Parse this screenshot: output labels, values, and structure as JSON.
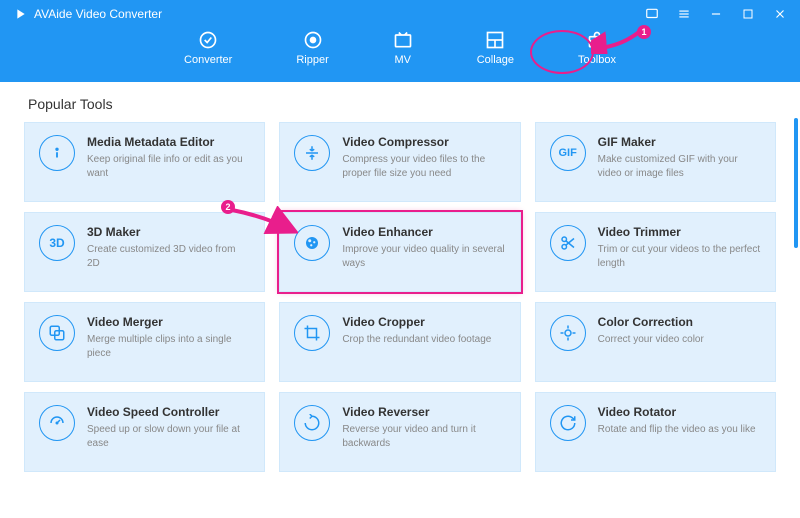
{
  "app": {
    "title": "AVAide Video Converter"
  },
  "tabs": [
    {
      "label": "Converter",
      "icon": "converter"
    },
    {
      "label": "Ripper",
      "icon": "ripper"
    },
    {
      "label": "MV",
      "icon": "mv"
    },
    {
      "label": "Collage",
      "icon": "collage"
    },
    {
      "label": "Toolbox",
      "icon": "toolbox"
    }
  ],
  "section": {
    "title": "Popular Tools"
  },
  "tools": [
    {
      "title": "Media Metadata Editor",
      "desc": "Keep original file info or edit as you want",
      "icon": "info"
    },
    {
      "title": "Video Compressor",
      "desc": "Compress your video files to the proper file size you need",
      "icon": "compress"
    },
    {
      "title": "GIF Maker",
      "desc": "Make customized GIF with your video or image files",
      "icon": "gif"
    },
    {
      "title": "3D Maker",
      "desc": "Create customized 3D video from 2D",
      "icon": "3d"
    },
    {
      "title": "Video Enhancer",
      "desc": "Improve your video quality in several ways",
      "icon": "enhance"
    },
    {
      "title": "Video Trimmer",
      "desc": "Trim or cut your videos to the perfect length",
      "icon": "trim"
    },
    {
      "title": "Video Merger",
      "desc": "Merge multiple clips into a single piece",
      "icon": "merge"
    },
    {
      "title": "Video Cropper",
      "desc": "Crop the redundant video footage",
      "icon": "crop"
    },
    {
      "title": "Color Correction",
      "desc": "Correct your video color",
      "icon": "color"
    },
    {
      "title": "Video Speed Controller",
      "desc": "Speed up or slow down your file at ease",
      "icon": "speed"
    },
    {
      "title": "Video Reverser",
      "desc": "Reverse your video and turn it backwards",
      "icon": "reverse"
    },
    {
      "title": "Video Rotator",
      "desc": "Rotate and flip the video as you like",
      "icon": "rotate"
    }
  ],
  "annotations": {
    "badge1": "1",
    "badge2": "2"
  }
}
